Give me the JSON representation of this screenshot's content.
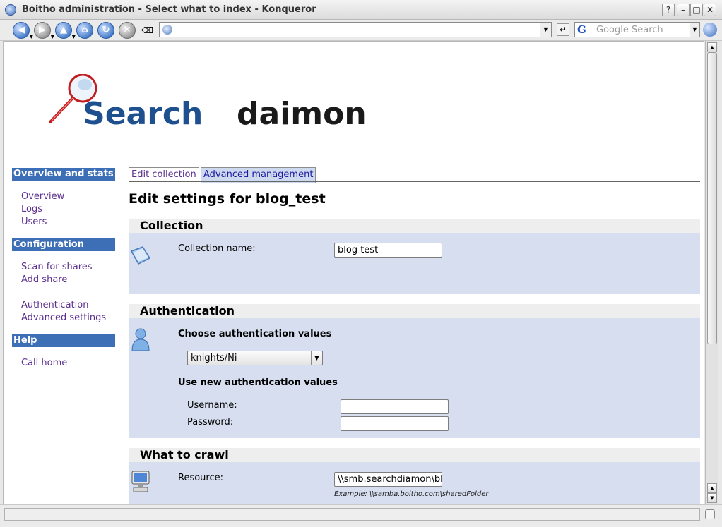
{
  "window": {
    "title": "Boitho administration - Select what to index - Konqueror",
    "buttons": {
      "help": "?",
      "minimize": "–",
      "maximize": "□",
      "close": "✕"
    }
  },
  "toolbar": {
    "back_glyph": "◀",
    "forward_glyph": "▶",
    "up_glyph": "▲",
    "home_glyph": "⌂",
    "reload_glyph": "↻",
    "stop_glyph": "✕",
    "clear_glyph": "⌫",
    "url_value": "",
    "go_glyph": "↵",
    "search_placeholder": "Google Search",
    "search_engine_letter": "G",
    "dropdown_glyph": "▼"
  },
  "logo": {
    "text_part1": "Search",
    "text_part2": "daimon"
  },
  "sidebar": {
    "sections": [
      {
        "header": "Overview and stats",
        "links": [
          "Overview",
          "Logs",
          "Users"
        ]
      },
      {
        "header": "Configuration",
        "links": [
          "Scan for shares",
          "Add share",
          "Authentication",
          "Advanced settings"
        ]
      },
      {
        "header": "Help",
        "links": [
          "Call home"
        ]
      }
    ]
  },
  "tabs": [
    {
      "label": "Edit collection",
      "active": true
    },
    {
      "label": "Advanced management",
      "active": false
    }
  ],
  "page": {
    "title": "Edit settings for blog_test",
    "collection": {
      "heading": "Collection",
      "name_label": "Collection name:",
      "name_value": "blog test"
    },
    "authentication": {
      "heading": "Authentication",
      "choose_label": "Choose authentication values",
      "selected_value": "knights/Ni",
      "new_label": "Use new authentication values",
      "username_label": "Username:",
      "username_value": "",
      "password_label": "Password:",
      "password_value": ""
    },
    "crawl": {
      "heading": "What to crawl",
      "resource_label": "Resource:",
      "resource_value": "\\\\smb.searchdiamon\\blog",
      "example": "Example: \\\\samba.boitho.com\\sharedFolder"
    }
  },
  "colors": {
    "sidebar_header": "#3d6fb6",
    "link": "#5b2f8f",
    "section_body": "#d6deef",
    "logo_blue": "#1e4f8f",
    "logo_dark": "#1a1a1a"
  }
}
